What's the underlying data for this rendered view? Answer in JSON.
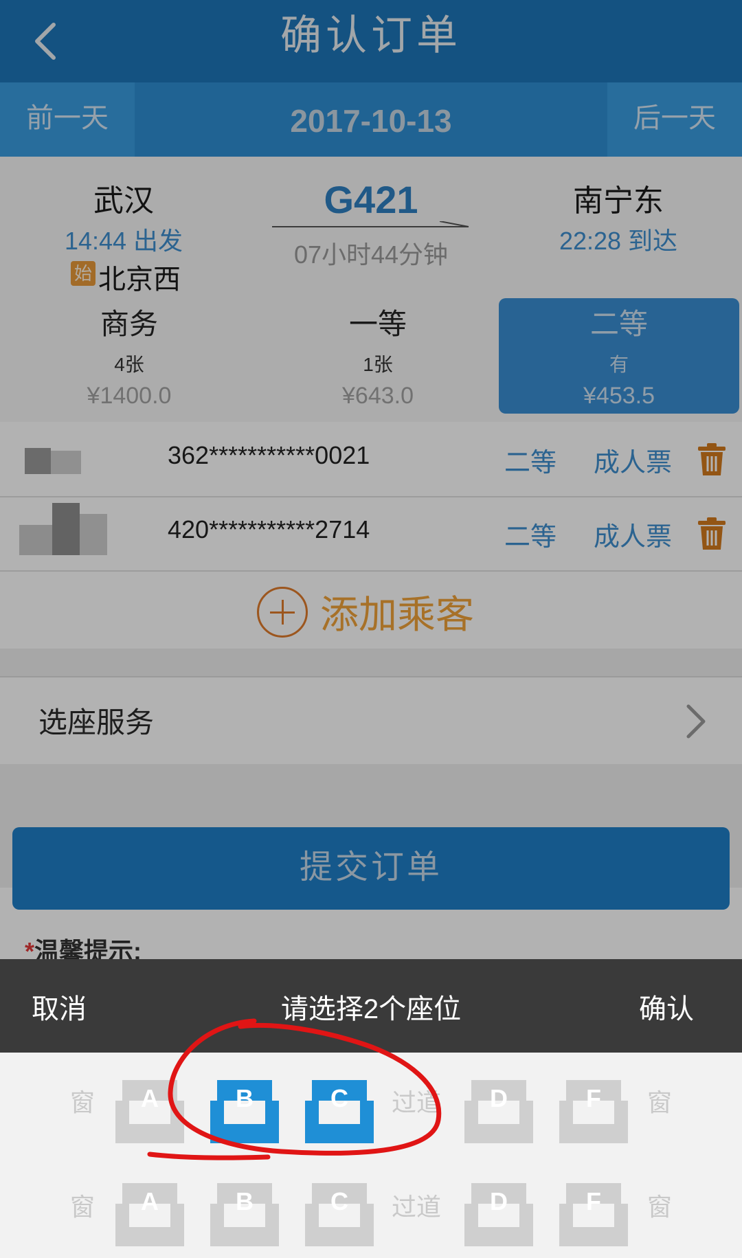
{
  "header": {
    "title": "确认订单"
  },
  "datebar": {
    "prev": "前一天",
    "date": "2017-10-13",
    "next": "后一天"
  },
  "train": {
    "from_name": "武汉",
    "from_time": "14:44 出发",
    "number": "G421",
    "duration": "07小时44分钟",
    "to_name": "南宁东",
    "to_time": "22:28 到达",
    "origin_badge": "始",
    "origin_name": "北京西"
  },
  "classes": [
    {
      "name": "商务",
      "count": "4张",
      "price": "¥1400.0"
    },
    {
      "name": "一等",
      "count": "1张",
      "price": "¥643.0"
    },
    {
      "name": "二等",
      "count": "有",
      "price": "¥453.5"
    }
  ],
  "passengers": [
    {
      "id": "362***********0021",
      "seat_class": "二等",
      "ticket_type": "成人票"
    },
    {
      "id": "420***********2714",
      "seat_class": "二等",
      "ticket_type": "成人票"
    }
  ],
  "add_passenger": "添加乘客",
  "seat_service": "选座服务",
  "submit": "提交订单",
  "tips": {
    "star": "*",
    "label": "温馨提示:"
  },
  "picker": {
    "cancel": "取消",
    "prompt": "请选择2个座位",
    "confirm": "确认",
    "window": "窗",
    "aisle": "过道",
    "row1": [
      "A",
      "B",
      "C",
      "D",
      "F"
    ],
    "row2": [
      "A",
      "B",
      "C",
      "D",
      "F"
    ],
    "selected_row1": [
      "B",
      "C"
    ]
  },
  "colors": {
    "accent": "#1d76b9",
    "selected_seat": "#1f8fd6",
    "unselected_seat": "#cfcfcf",
    "orange": "#f0a23a"
  }
}
